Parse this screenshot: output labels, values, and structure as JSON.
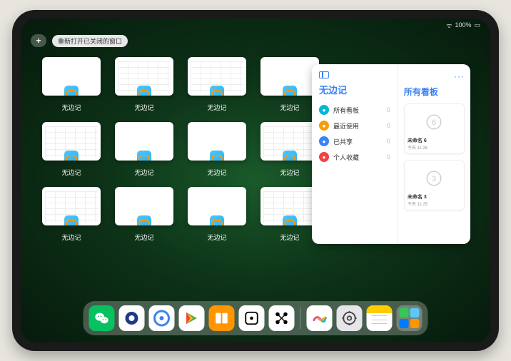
{
  "status": {
    "signal": "●●●",
    "wifi": "📶",
    "battery": "100%"
  },
  "topbar": {
    "plus": "+",
    "reopen_label": "重新打开已关闭的窗口"
  },
  "app_name": "无边记",
  "grid": {
    "windows": [
      {
        "label": "无边记",
        "style": "blank"
      },
      {
        "label": "无边记",
        "style": "grid"
      },
      {
        "label": "无边记",
        "style": "grid"
      },
      {
        "label": "无边记",
        "style": "blank"
      },
      {
        "label": "无边记",
        "style": "grid"
      },
      {
        "label": "无边记",
        "style": "blank"
      },
      {
        "label": "无边记",
        "style": "blank"
      },
      {
        "label": "无边记",
        "style": "grid"
      },
      {
        "label": "无边记",
        "style": "grid"
      },
      {
        "label": "无边记",
        "style": "blank"
      },
      {
        "label": "无边记",
        "style": "blank"
      },
      {
        "label": "无边记",
        "style": "grid"
      }
    ]
  },
  "panel": {
    "left_title": "无边记",
    "right_title": "所有看板",
    "more": "···",
    "nav": [
      {
        "label": "所有看板",
        "count": "0",
        "color": "#06b6d4"
      },
      {
        "label": "最近使用",
        "count": "0",
        "color": "#f59e0b"
      },
      {
        "label": "已共享",
        "count": "0",
        "color": "#3b82f6"
      },
      {
        "label": "个人收藏",
        "count": "0",
        "color": "#ef4444"
      }
    ],
    "boards": [
      {
        "name": "未命名 6",
        "date": "今天 11:26",
        "digit": "6"
      },
      {
        "name": "未命名 3",
        "date": "今天 11:25",
        "digit": "3"
      }
    ]
  },
  "dock": {
    "apps": [
      {
        "name": "wechat",
        "bg": "#07C160"
      },
      {
        "name": "quark",
        "bg": "#ffffff"
      },
      {
        "name": "browser",
        "bg": "#ffffff"
      },
      {
        "name": "play",
        "bg": "#ffffff"
      },
      {
        "name": "books",
        "bg": "#FF9500"
      },
      {
        "name": "dice",
        "bg": "#ffffff"
      },
      {
        "name": "nodes",
        "bg": "#ffffff"
      }
    ],
    "recent": [
      {
        "name": "freeform",
        "bg": "#ffffff"
      },
      {
        "name": "settings",
        "bg": "#8e8e93"
      },
      {
        "name": "notes",
        "bg": "#ffffff"
      }
    ]
  }
}
